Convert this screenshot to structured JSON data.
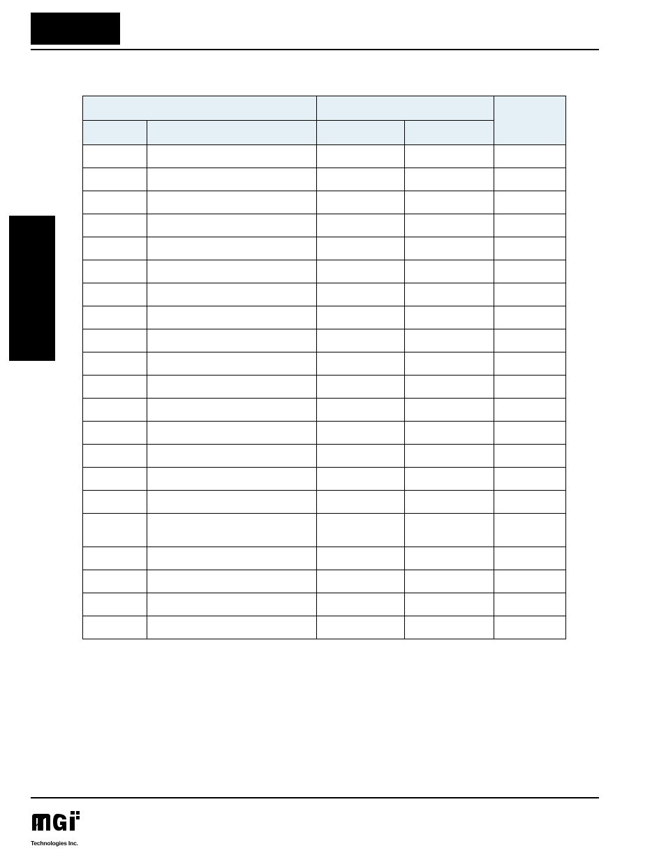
{
  "logo": {
    "brand": "mGi",
    "sub": "Technologies Inc."
  },
  "table": {
    "header_group_left": "",
    "header_group_right": "",
    "header_last": "",
    "cols": [
      "",
      "",
      "",
      "",
      ""
    ],
    "rows": [
      [
        "",
        "",
        "",
        "",
        ""
      ],
      [
        "",
        "",
        "",
        "",
        ""
      ],
      [
        "",
        "",
        "",
        "",
        ""
      ],
      [
        "",
        "",
        "",
        "",
        ""
      ],
      [
        "",
        "",
        "",
        "",
        ""
      ],
      [
        "",
        "",
        "",
        "",
        ""
      ],
      [
        "",
        "",
        "",
        "",
        ""
      ],
      [
        "",
        "",
        "",
        "",
        ""
      ],
      [
        "",
        "",
        "",
        "",
        ""
      ],
      [
        "",
        "",
        "",
        "",
        ""
      ],
      [
        "",
        "",
        "",
        "",
        ""
      ],
      [
        "",
        "",
        "",
        "",
        ""
      ],
      [
        "",
        "",
        "",
        "",
        ""
      ],
      [
        "",
        "",
        "",
        "",
        ""
      ],
      [
        "",
        "",
        "",
        "",
        ""
      ],
      [
        "",
        "",
        "",
        "",
        ""
      ],
      [
        "",
        "",
        "",
        "",
        ""
      ],
      [
        "",
        "",
        "",
        "",
        ""
      ],
      [
        "",
        "",
        "",
        "",
        ""
      ],
      [
        "",
        "",
        "",
        "",
        ""
      ],
      [
        "",
        "",
        "",
        "",
        ""
      ]
    ],
    "tall_row_index": 16
  }
}
